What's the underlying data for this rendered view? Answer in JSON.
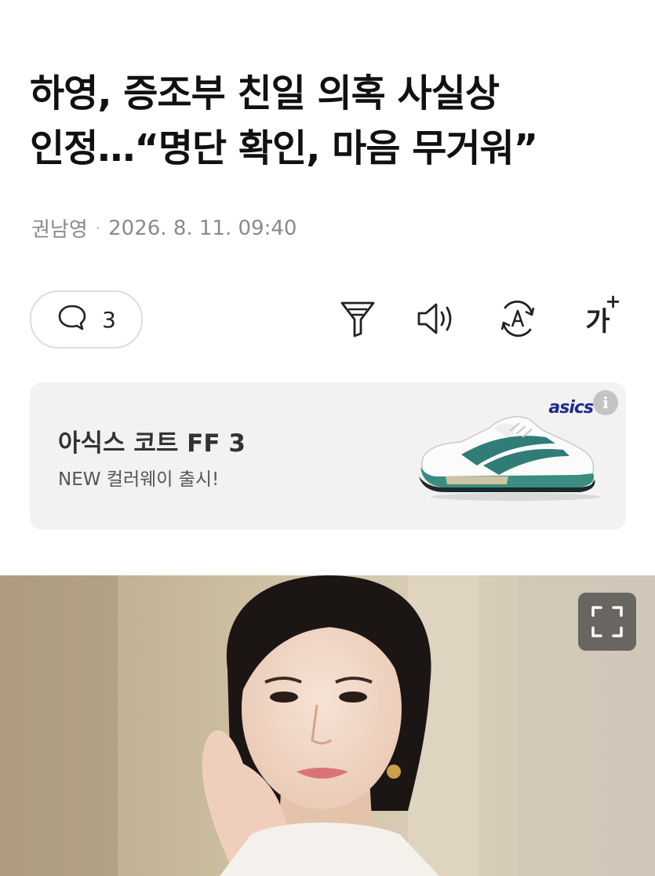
{
  "article": {
    "headline_line1": "하영, 증조부 친일 의혹 사실상",
    "headline_line2": "인정…“명단 확인, 마음 무거워”",
    "author": "권남영",
    "separator": "·",
    "datetime": "2026. 8. 11. 09:40"
  },
  "toolbar": {
    "comment_count": "3",
    "font_size_label": "가",
    "font_size_plus": "+",
    "icons": [
      "comment-icon",
      "summary-filter-icon",
      "speaker-icon",
      "translate-icon",
      "font-size-icon"
    ]
  },
  "ad": {
    "title": "아식스 코트 FF 3",
    "subtitle": "NEW 컬러웨이 출시!",
    "brand": "asics",
    "info_label": "i",
    "colors": {
      "background": "#f2f2f2",
      "shoe_accent": "#2f7d76",
      "brand": "#1e2c8a"
    }
  },
  "hero_image": {
    "icons": [
      "fullscreen-icon"
    ]
  }
}
